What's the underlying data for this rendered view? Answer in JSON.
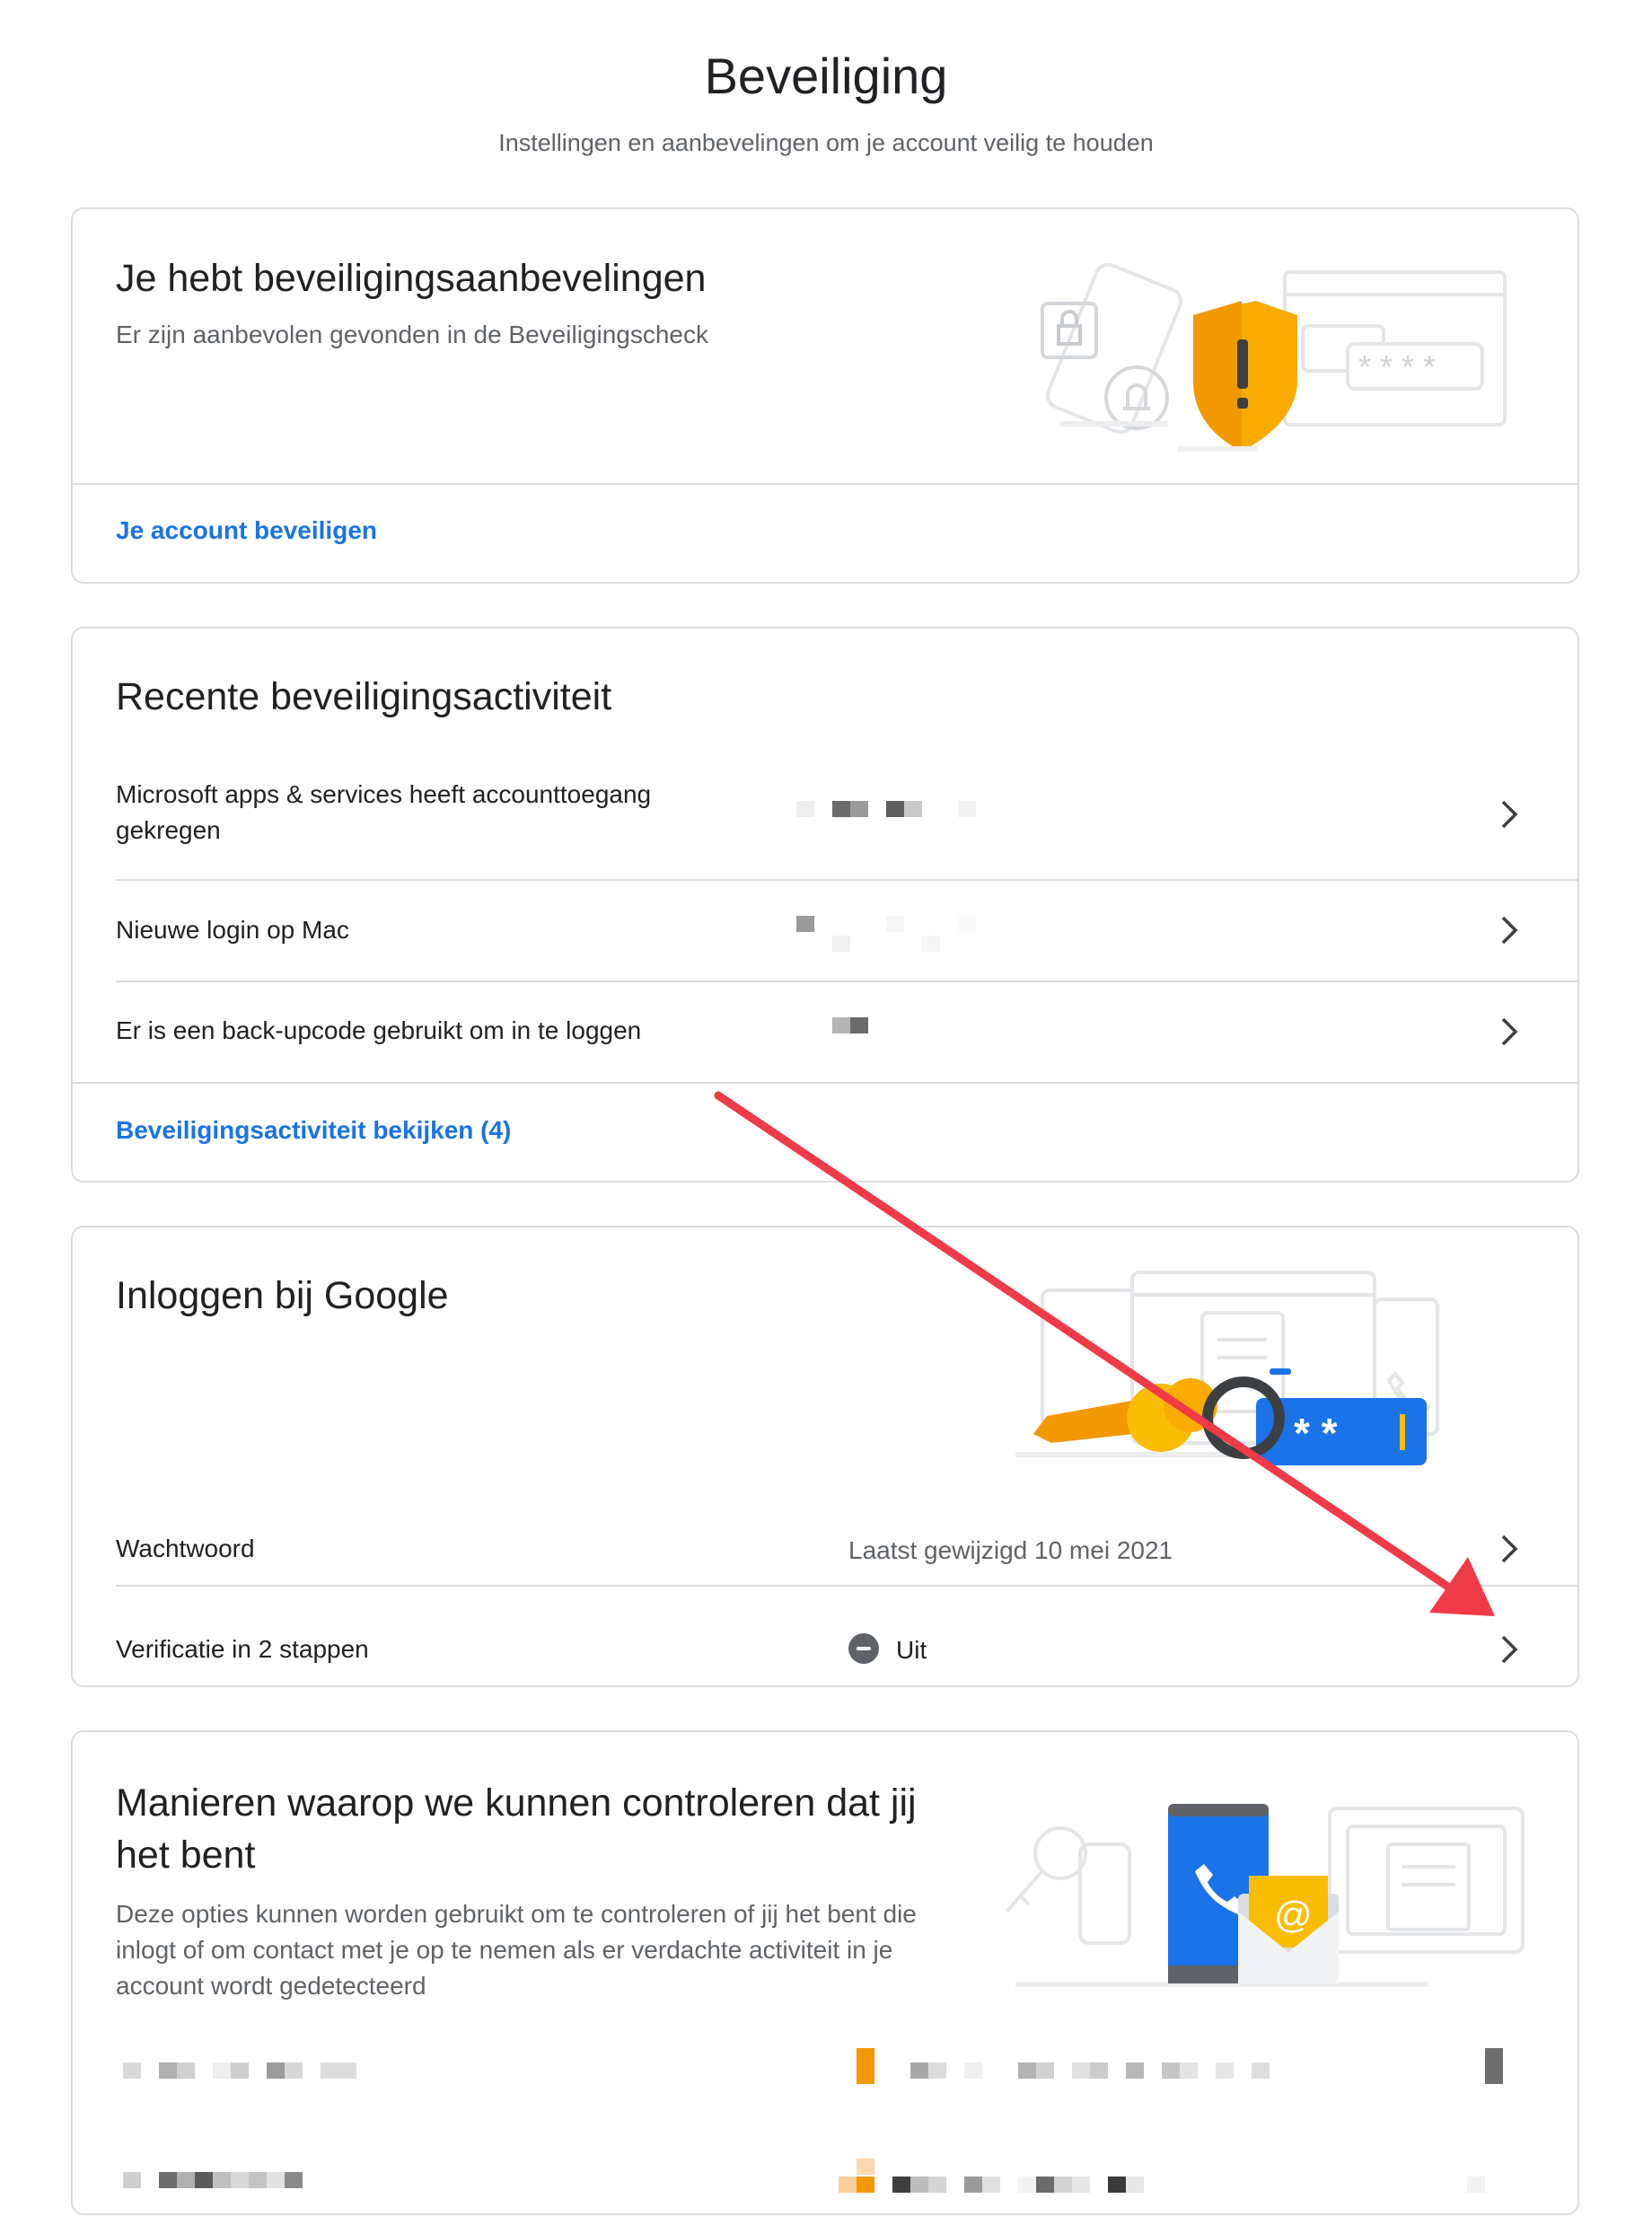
{
  "header": {
    "title": "Beveiliging",
    "subtitle": "Instellingen en aanbevelingen om je account veilig te houden"
  },
  "recommendations": {
    "title": "Je hebt beveiligingsaanbevelingen",
    "description": "Er zijn aanbevolen gevonden in de Beveiligingscheck",
    "link": "Je account beveiligen",
    "illustration_text": "* * * *"
  },
  "activity": {
    "title": "Recente beveiligingsactiviteit",
    "items": [
      {
        "label": "Microsoft apps & services heeft accounttoegang gekregen"
      },
      {
        "label": "Nieuwe login op Mac"
      },
      {
        "label": "Er is een back-upcode gebruikt om in te loggen"
      }
    ],
    "link": "Beveiligingsactiviteit bekijken (4)"
  },
  "signin": {
    "title": "Inloggen bij Google",
    "illustration_text": "* *",
    "rows": [
      {
        "label": "Wachtwoord",
        "value": "Laatst gewijzigd 10 mei 2021"
      },
      {
        "label": "Verificatie in 2 stappen",
        "value": "Uit"
      }
    ]
  },
  "verify": {
    "title": "Manieren waarop we kunnen controleren dat jij het bent",
    "description": "Deze opties kunnen worden gebruikt om te controleren of jij het bent die inlogt of om contact met je op te nemen als er verdachte activiteit in je account wordt gedetecteerd",
    "illustration_text": "@"
  },
  "colors": {
    "link": "#1a73e8",
    "annotation_arrow": "#f03a47",
    "shield": "#f9ab00",
    "key": "#fbbc04",
    "phone": "#1a73e8"
  },
  "icons": [
    "chevron-right-icon",
    "minus-circle-icon",
    "shield-alert-icon",
    "key-icon",
    "phone-icon",
    "mail-icon",
    "lock-icon",
    "bell-icon"
  ]
}
